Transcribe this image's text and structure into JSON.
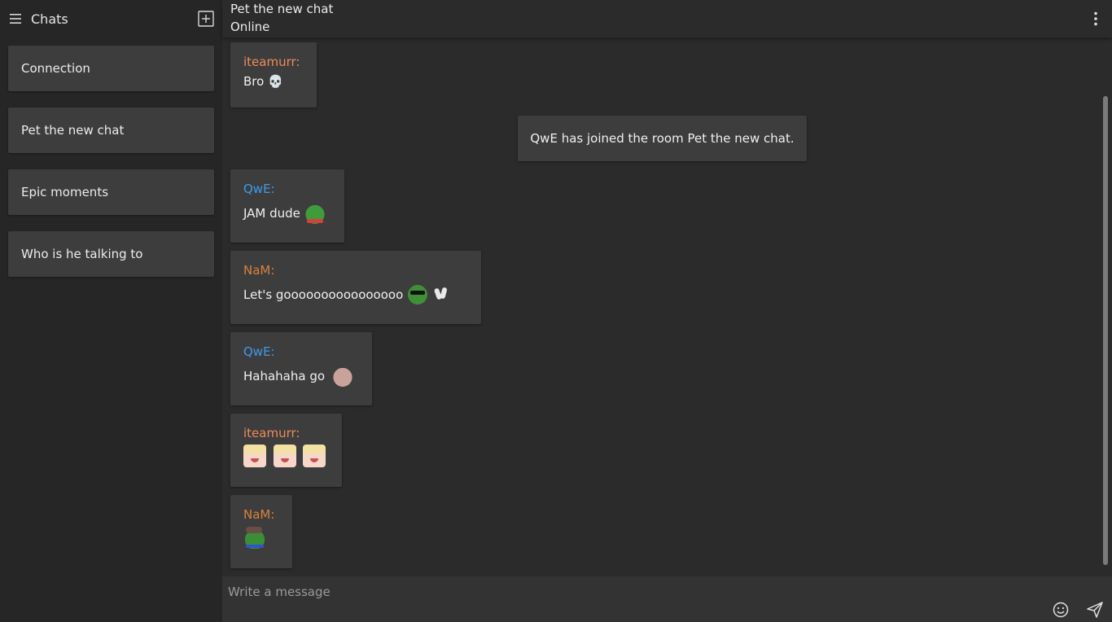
{
  "sidebar": {
    "title": "Chats",
    "menu_icon": "hamburger-menu-icon",
    "add_icon": "add-chat-icon",
    "chats": [
      {
        "label": "Connection"
      },
      {
        "label": "Pet the new chat"
      },
      {
        "label": "Epic moments"
      },
      {
        "label": "Who is he talking to"
      }
    ]
  },
  "header": {
    "title": "Pet the new chat",
    "status": "Online",
    "more_icon": "more-vert-icon"
  },
  "messages": [
    {
      "author": "iteamurr:",
      "text": "Bro",
      "emotes": [
        "skull-emoji"
      ]
    },
    {
      "system": "QwE has joined the room Pet the new chat."
    },
    {
      "author": "QwE:",
      "text": "JAM dude",
      "emotes": [
        "frog-jam-emote"
      ]
    },
    {
      "author": "NaM:",
      "text": "Let's goooooooooooooooo",
      "emotes": [
        "frog-sunglasses-emote",
        "clapping-hands-emote"
      ]
    },
    {
      "author": "QwE:",
      "text": "Hahahaha go",
      "emotes": [
        "hand-emote"
      ]
    },
    {
      "author": "iteamurr:",
      "text": "",
      "emotes": [
        "anime-laugh-emote",
        "anime-laugh-emote",
        "anime-laugh-emote"
      ]
    },
    {
      "author": "NaM:",
      "text": "",
      "emotes": [
        "frog-hand-emote"
      ]
    }
  ],
  "colors": {
    "author_orange": "#ef8a5a",
    "author_blue": "#3d9be9",
    "author_amber": "#d9823b",
    "bubble_bg": "#3d3d3d",
    "app_bg": "#2b2b2b"
  },
  "composer": {
    "placeholder": "Write a message",
    "emoji_icon": "emoji-smile-icon",
    "send_icon": "send-paper-plane-icon"
  }
}
